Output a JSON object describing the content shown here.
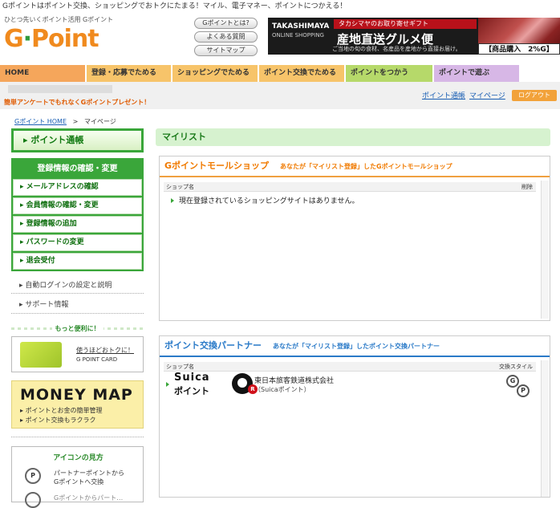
{
  "top_notice": "Gポイントはポイント交換、ショッピングでおトクにたまる！マイル、電子マネー、ポイントにつかえる！",
  "tagline": "ひとつ先いくポイント活用 Gポイント",
  "logo": {
    "g": "G",
    "point": "Point"
  },
  "header_buttons": [
    "Gポイントとは?",
    "よくある質問",
    "サイトマップ"
  ],
  "banner": {
    "brand": "TAKASHIMAYA",
    "brand_sub": "ONLINE SHOPPING",
    "tag": "タカシマヤのお取り寄せギフト",
    "headline": "産地直送グルメ便",
    "sub": "ご当地の旬の食材、名産品を産地から直接お届け。",
    "price": "【商品購入　2%G】"
  },
  "nav": {
    "tabs": [
      {
        "label": "HOME",
        "color": "#f5a65b"
      },
      {
        "label": "登録・応募でためる",
        "color": "#f7c46a"
      },
      {
        "label": "ショッピングでためる",
        "color": "#f7c46a"
      },
      {
        "label": "ポイント交換でためる",
        "color": "#f7c46a"
      },
      {
        "label": "ポイントをつかう",
        "color": "#b6d96a"
      },
      {
        "label": "ポイントで遊ぶ",
        "color": "#d7b7e6"
      }
    ]
  },
  "present": "簡単アンケートでもれなくGポイントプレゼント！",
  "sublinks": {
    "passbook": "ポイント通帳",
    "mypage": "マイページ",
    "logout": "ログアウト"
  },
  "breadcrumb": {
    "home": "Gポイント HOME",
    "sep": ">",
    "current": "マイページ"
  },
  "sidebar": {
    "passbook": "ポイント通帳",
    "account_header": "登録情報の確認・変更",
    "account_items": [
      "メールアドレスの確認",
      "会員情報の確認・変更",
      "登録情報の追加",
      "パスワードの変更",
      "退会受付"
    ],
    "links": [
      "自動ログインの設定と説明",
      "サポート情報"
    ],
    "more": "もっと便利に！",
    "card": {
      "text": "使うほどおトクに！",
      "sub": "G POINT CARD"
    },
    "moneymap": {
      "title": "MONEY MAP",
      "line1": "ポイントとお金の簡単管理",
      "line2": "ポイント交換もラクラク"
    },
    "icon_guide": {
      "title": "アイコンの見方",
      "line1": "パートナーポイントから",
      "line2": "Gポイントへ交換",
      "line3": "Gポイントからパート…"
    }
  },
  "main": {
    "title": "マイリスト",
    "mall": {
      "title": "Gポイントモールショップ",
      "sub": "あなたが「マイリスト登録」したGポイントモールショップ",
      "col_shop": "ショップ名",
      "col_delete": "削除",
      "empty": "現在登録されているショッピングサイトはありません。"
    },
    "partner": {
      "title": "ポイント交換パートナー",
      "sub": "あなたが「マイリスト登録」したポイント交換パートナー",
      "col_shop": "ショップ名",
      "col_style": "交換スタイル",
      "rows": [
        {
          "logo_top": "Suica",
          "logo_bottom": "ポイント",
          "name": "東日本旅客鉄道株式会社",
          "sub": "（Suicaポイント）"
        }
      ]
    }
  }
}
